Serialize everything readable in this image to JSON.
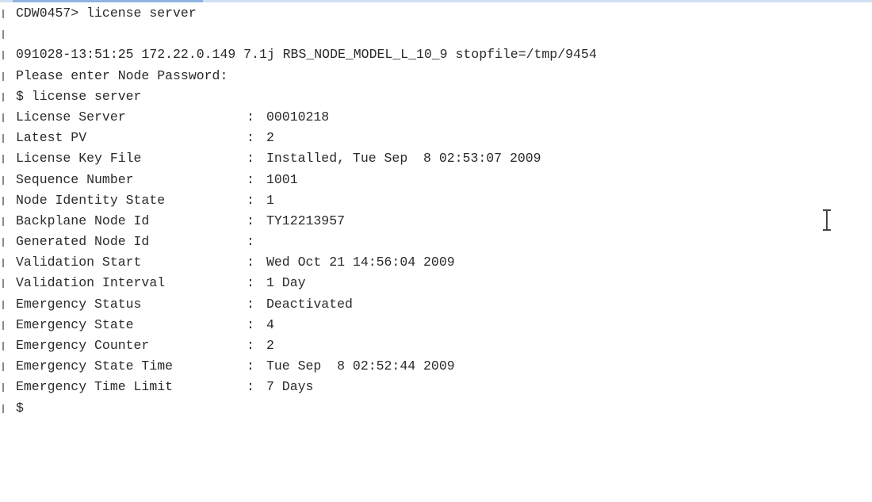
{
  "terminal": {
    "prompt_line": "CDW0457> license server",
    "blank_line": "",
    "header_line": "091028-13:51:25 172.22.0.149 7.1j RBS_NODE_MODEL_L_10_9 stopfile=/tmp/9454",
    "password_prompt": "Please enter Node Password:",
    "command_line": "$ license server",
    "fields": [
      {
        "label": "License Server",
        "sep": ":",
        "value": "00010218"
      },
      {
        "label": "Latest PV",
        "sep": ":",
        "value": "2"
      },
      {
        "label": "License Key File",
        "sep": ":",
        "value": "Installed, Tue Sep  8 02:53:07 2009"
      },
      {
        "label": "Sequence Number",
        "sep": ":",
        "value": "1001"
      },
      {
        "label": "Node Identity State",
        "sep": ":",
        "value": "1"
      },
      {
        "label": "Backplane Node Id",
        "sep": ":",
        "value": "TY12213957"
      },
      {
        "label": "Generated Node Id",
        "sep": ":",
        "value": ""
      },
      {
        "label": "Validation Start",
        "sep": ":",
        "value": "Wed Oct 21 14:56:04 2009"
      },
      {
        "label": "Validation Interval",
        "sep": ":",
        "value": "1 Day"
      },
      {
        "label": "Emergency Status",
        "sep": ":",
        "value": "Deactivated"
      },
      {
        "label": "Emergency State",
        "sep": ":",
        "value": "4"
      },
      {
        "label": "Emergency Counter",
        "sep": ":",
        "value": "2"
      },
      {
        "label": "Emergency State Time",
        "sep": ":",
        "value": "Tue Sep  8 02:52:44 2009"
      },
      {
        "label": "Emergency Time Limit",
        "sep": ":",
        "value": "7 Days"
      }
    ],
    "final_prompt": "$"
  },
  "colors": {
    "background": "#ffffff",
    "text": "#2a2a2a",
    "gutter": "#8a8a8a",
    "top_border": "#cfe0f2"
  },
  "icons": {
    "cursor": "i-beam-cursor-icon"
  }
}
